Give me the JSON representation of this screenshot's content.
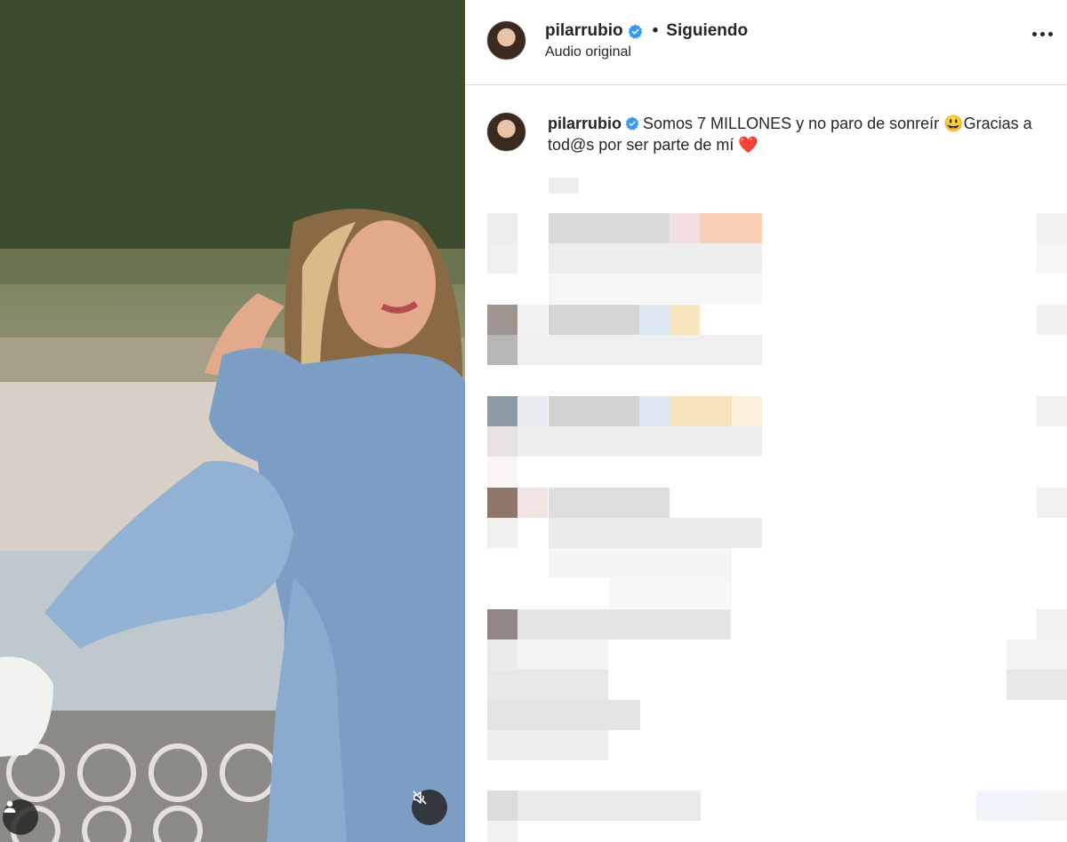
{
  "post": {
    "username": "pilarrubio",
    "follow_status": "Siguiendo",
    "separator": "•",
    "audio": "Audio original",
    "caption": "Somos 7 MILLONES y no paro de sonreír 😃Gracias a tod@s por ser parte de mí ❤️"
  },
  "icons": {
    "verified": "verified-badge-icon",
    "more": "more-options-icon",
    "user_tag": "user-tag-icon",
    "mute": "muted-audio-icon"
  },
  "colors": {
    "verified": "#3897f0",
    "text": "#262626",
    "divider": "#dbdbdb"
  }
}
